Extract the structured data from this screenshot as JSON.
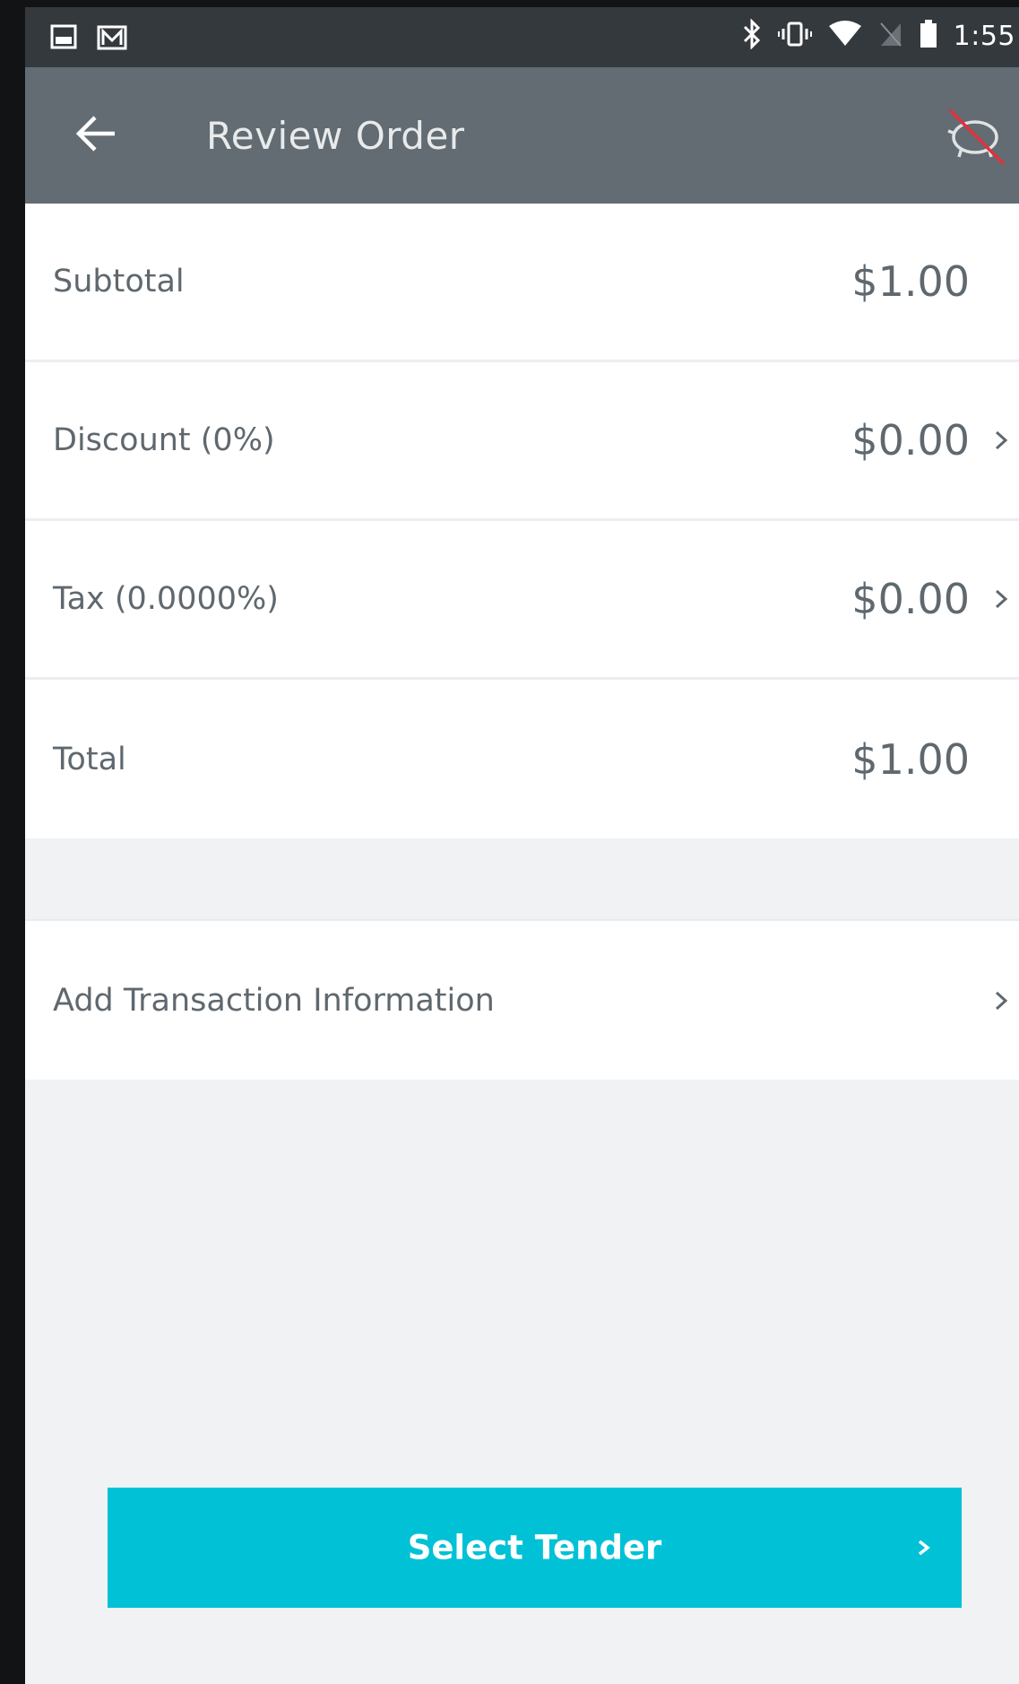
{
  "status_bar": {
    "time": "1:55",
    "left_icons": [
      "gallery-icon",
      "gmail-icon"
    ],
    "right_icons": [
      "bluetooth-icon",
      "vibrate-icon",
      "wifi-icon",
      "no-sim-icon",
      "battery-icon"
    ]
  },
  "app_bar": {
    "title": "Review Order",
    "back_icon": "arrow-left-icon",
    "action_icon": "offline-piggy-bank-icon"
  },
  "summary": {
    "rows": [
      {
        "label": "Subtotal",
        "value": "$1.00",
        "has_chevron": false
      },
      {
        "label": "Discount (0%)",
        "value": "$0.00",
        "has_chevron": true
      },
      {
        "label": "Tax (0.0000%)",
        "value": "$0.00",
        "has_chevron": true
      },
      {
        "label": "Total",
        "value": "$1.00",
        "has_chevron": false
      }
    ]
  },
  "transaction_info": {
    "label": "Add Transaction Information"
  },
  "tender_button": {
    "label": "Select Tender"
  },
  "colors": {
    "status_bar": "#34393e",
    "app_bar": "#626c72",
    "accent": "#01c1d6",
    "background": "#f1f2f4",
    "text": "#5f686e"
  }
}
